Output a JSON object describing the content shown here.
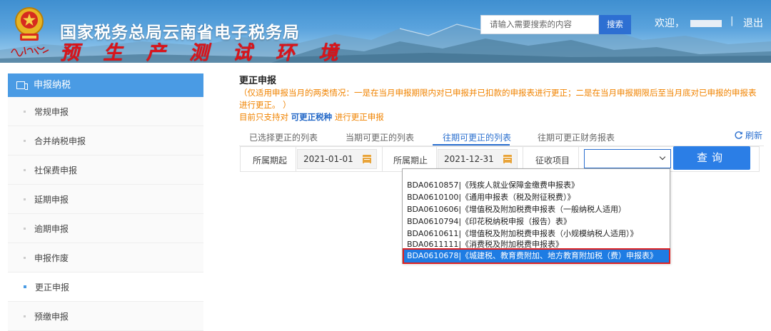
{
  "header": {
    "title": "国家税务总局云南省电子税务局",
    "env_label": "预 生 产 测 试 环 境",
    "search_placeholder": "请输入需要搜索的内容",
    "search_button": "搜索",
    "welcome": "欢迎，",
    "separator": "|",
    "logout": "退出",
    "colors": {
      "banner": "#4b98d8",
      "search_button": "#2d6fd2",
      "env_text": "#d8141b"
    }
  },
  "sidebar": {
    "heading": "申报纳税",
    "items": [
      {
        "label": "常规申报",
        "active": false
      },
      {
        "label": "合并纳税申报",
        "active": false
      },
      {
        "label": "社保费申报",
        "active": false
      },
      {
        "label": "延期申报",
        "active": false
      },
      {
        "label": "逾期申报",
        "active": false
      },
      {
        "label": "申报作废",
        "active": false
      },
      {
        "label": "更正申报",
        "active": true
      },
      {
        "label": "预缴申报",
        "active": false
      }
    ],
    "colors": {
      "heading_bg": "#4a9be4"
    }
  },
  "main": {
    "title": "更正申报",
    "notice": "（仅适用申报当月的两类情况：一是在当月申报期限内对已申报并已扣款的申报表进行更正；二是在当月申报期限后至当月底对已申报的申报表进行更正。 ）",
    "notice2_prefix": "目前只支持对",
    "notice2_highlight": "可更正税种",
    "notice2_suffix": "进行更正申报",
    "tabs": [
      {
        "label": "已选择更正的列表",
        "active": false
      },
      {
        "label": "当期可更正的列表",
        "active": false
      },
      {
        "label": "往期可更正的列表",
        "active": true
      },
      {
        "label": "往期可更正财务报表",
        "active": false
      }
    ],
    "refresh": "刷新",
    "form": {
      "start_label": "所属期起",
      "start_value": "2021-01-01",
      "end_label": "所属期止",
      "end_value": "2021-12-31",
      "item_label": "征收项目",
      "item_value": "",
      "query_button": "查询"
    },
    "dropdown_options": [
      "BDA0610857|《残疾人就业保障金缴费申报表》",
      "BDA0610100|《通用申报表（税及附征税费）》",
      "BDA0610606|《增值税及附加税费申报表（一般纳税人适用）",
      "BDA0610794|《印花税纳税申报（报告）表》",
      "BDA0610611|《增值税及附加税费申报表（小规模纳税人适用）》",
      "BDA0611111|《消费税及附加税费申报表》",
      "BDA0610678|《城建税、教育费附加、地方教育附加税（费）申报表》"
    ],
    "dropdown_selected_index": 6,
    "colors": {
      "accent": "#2a6fcf",
      "notice": "#f08300",
      "highlight_frame": "#e02020"
    }
  }
}
